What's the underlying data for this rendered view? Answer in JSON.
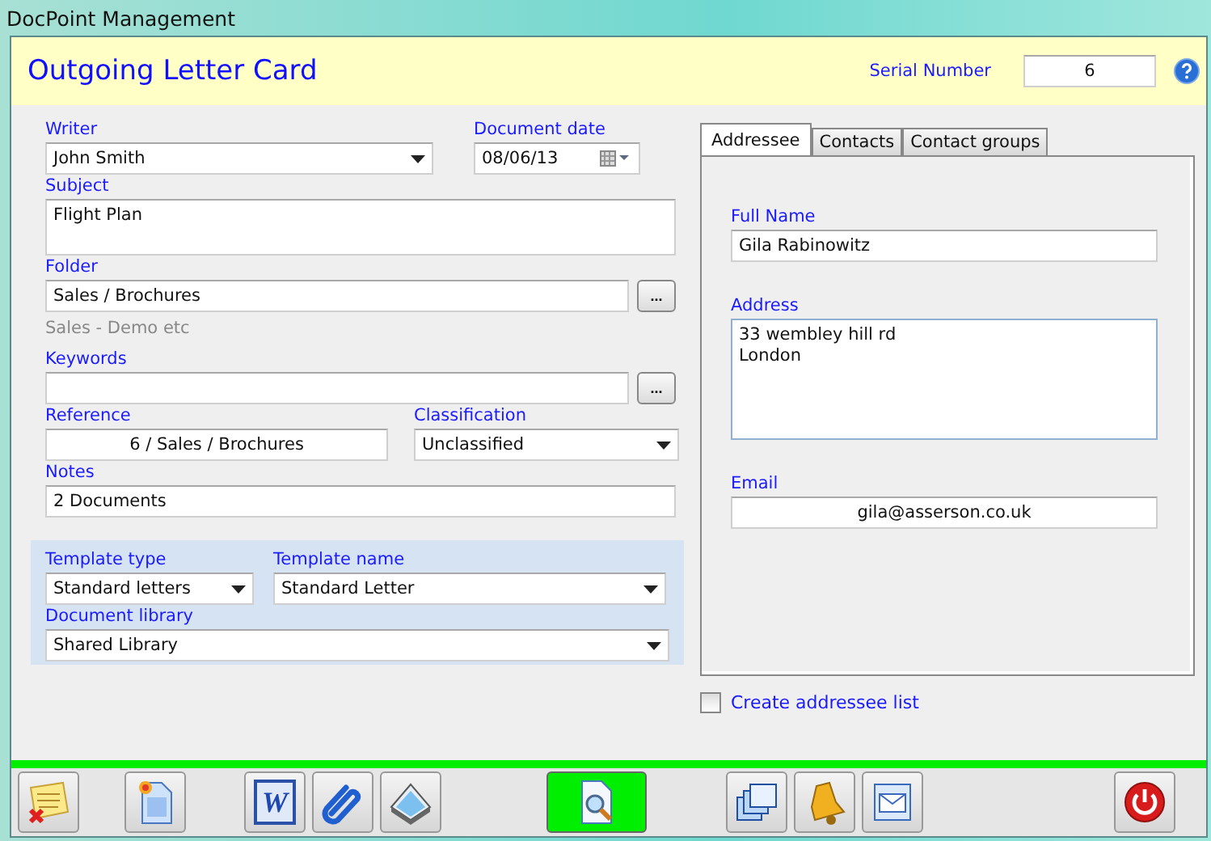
{
  "window": {
    "title": "DocPoint  Management"
  },
  "header": {
    "title": "Outgoing Letter Card",
    "serial_label": "Serial Number",
    "serial_value": "6"
  },
  "writer": {
    "label": "Writer",
    "value": "John Smith"
  },
  "document_date": {
    "label": "Document date",
    "value": "08/06/13"
  },
  "subject": {
    "label": "Subject",
    "value": "Flight Plan"
  },
  "folder": {
    "label": "Folder",
    "value": "Sales / Brochures",
    "button": "...",
    "hint": "Sales - Demo etc"
  },
  "keywords": {
    "label": "Keywords",
    "button": "..."
  },
  "reference": {
    "label": "Reference",
    "value": "6 / Sales / Brochures"
  },
  "classification": {
    "label": "Classification",
    "value": "Unclassified"
  },
  "notes": {
    "label": "Notes",
    "value": "2 Documents"
  },
  "template_type": {
    "label": "Template type",
    "value": "Standard letters"
  },
  "template_name": {
    "label": "Template name",
    "value": "Standard Letter"
  },
  "document_library": {
    "label": "Document library",
    "value": "Shared Library"
  },
  "tabs": [
    {
      "label": "Addressee",
      "selected": true
    },
    {
      "label": "Contacts",
      "selected": false
    },
    {
      "label": "Contact groups",
      "selected": false
    }
  ],
  "full_name": {
    "label": "Full Name",
    "value": "Gila Rabinowitz"
  },
  "address": {
    "label": "Address",
    "lines": [
      "33 wembley hill rd",
      "London"
    ]
  },
  "email": {
    "label": "Email",
    "value": "gila@asserson.co.uk"
  },
  "create_list": {
    "label": "Create addressee list",
    "checked": false
  },
  "toolbar": [
    {
      "kind": "cancel",
      "selected": false
    },
    {
      "kind": "new",
      "selected": false
    },
    {
      "kind": "word",
      "letter": "W",
      "selected": false
    },
    {
      "kind": "attach",
      "selected": false
    },
    {
      "kind": "scan",
      "selected": false
    },
    {
      "kind": "preview",
      "selected": true
    },
    {
      "kind": "windows",
      "selected": false
    },
    {
      "kind": "bell",
      "selected": false
    },
    {
      "kind": "mail",
      "selected": false
    },
    {
      "kind": "power",
      "selected": false
    }
  ]
}
